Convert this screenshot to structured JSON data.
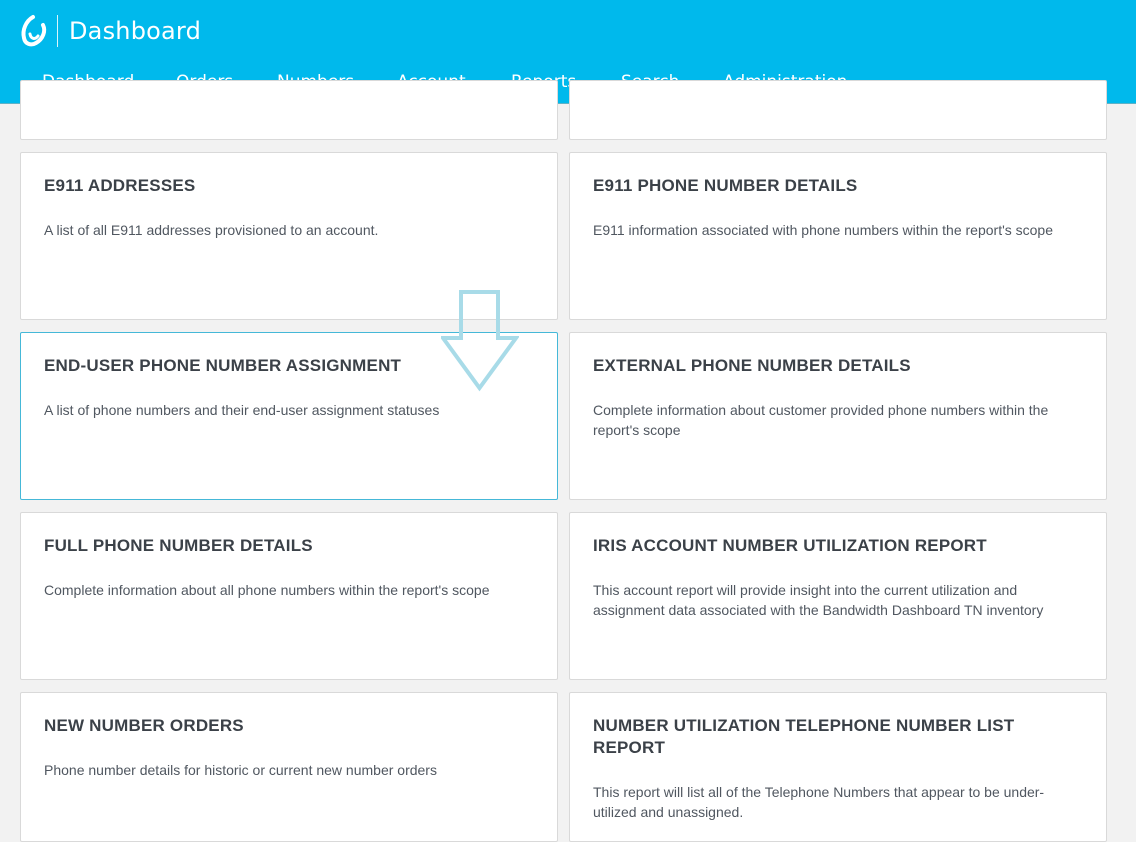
{
  "header": {
    "logo_icon": "bandwidth-logo-icon",
    "title": "Dashboard",
    "background": "#00b9ec"
  },
  "nav": {
    "items": [
      {
        "label": "Dashboard"
      },
      {
        "label": "Orders"
      },
      {
        "label": "Numbers"
      },
      {
        "label": "Account"
      },
      {
        "label": "Reports"
      },
      {
        "label": "Search"
      },
      {
        "label": "Administration"
      }
    ]
  },
  "reports": [
    {
      "title": "",
      "description": ""
    },
    {
      "title": "",
      "description": ""
    },
    {
      "title": "E911 ADDRESSES",
      "description": "A list of all E911 addresses provisioned to an account."
    },
    {
      "title": "E911 PHONE NUMBER DETAILS",
      "description": "E911 information associated with phone numbers within the report's scope"
    },
    {
      "title": "END-USER PHONE NUMBER ASSIGNMENT",
      "description": "A list of phone numbers and their end-user assignment statuses"
    },
    {
      "title": "EXTERNAL PHONE NUMBER DETAILS",
      "description": "Complete information about customer provided phone numbers within the report's scope"
    },
    {
      "title": "FULL PHONE NUMBER DETAILS",
      "description": "Complete information about all phone numbers within the report's scope"
    },
    {
      "title": "IRIS ACCOUNT NUMBER UTILIZATION REPORT",
      "description": "This account report will provide insight into the current utilization and assignment data associated with the Bandwidth Dashboard TN inventory"
    },
    {
      "title": "NEW NUMBER ORDERS",
      "description": "Phone number details for historic or current new number orders"
    },
    {
      "title": "NUMBER UTILIZATION TELEPHONE NUMBER LIST REPORT",
      "description": "This report will list all of the Telephone Numbers that appear to be under-utilized and unassigned."
    }
  ],
  "overlay": {
    "icon": "down-arrow-icon",
    "color": "#a8dbe8"
  }
}
